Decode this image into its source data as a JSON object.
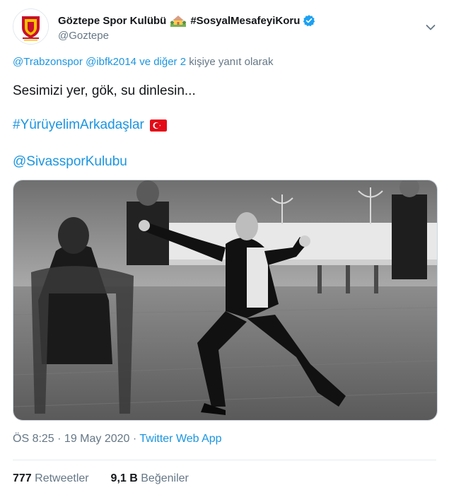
{
  "header": {
    "display_name_prefix": "Göztepe Spor Kulübü",
    "display_name_suffix": "#SosyalMesafeyiKoru",
    "handle": "@Goztepe",
    "house_icon": "house-with-garden-emoji",
    "verified_icon": "verified-badge-icon",
    "menu_icon": "chevron-down-icon"
  },
  "reply": {
    "mention1": "@Trabzonspor",
    "mention2": "@ibfk2014",
    "and_others": "ve diğer 2",
    "suffix": "kişiye yanıt olarak"
  },
  "tweet": {
    "line1": "Sesimizi yer, gök, su dinlesin...",
    "hashtag": "#YürüyelimArkadaşlar",
    "flag_icon": "turkey-flag-emoji",
    "mention": "@SivassporKulubu"
  },
  "media": {
    "icon": "tweet-photo"
  },
  "meta": {
    "time": "ÖS 8:25",
    "sep1": " · ",
    "date": "19 May 2020",
    "sep2": " · ",
    "source": "Twitter Web App"
  },
  "stats": {
    "retweets_count": "777",
    "retweets_label": "Retweetler",
    "likes_count": "9,1 B",
    "likes_label": "Beğeniler"
  },
  "colors": {
    "link": "#1b95e0",
    "muted": "#657786",
    "text": "#14171a",
    "brand_red": "#c8102e",
    "brand_yellow": "#f6c100"
  }
}
